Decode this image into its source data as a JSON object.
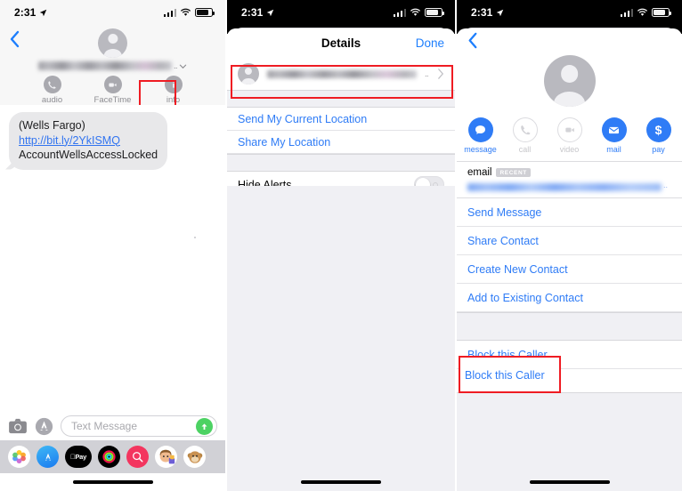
{
  "status_bar": {
    "time": "2:31",
    "location_icon": "location-arrow-icon",
    "cellular_icon": "cellular-bars-icon",
    "wifi_icon": "wifi-icon",
    "battery_icon": "battery-icon"
  },
  "colors": {
    "ios_blue": "#2f7cf6",
    "link_blue": "#1d7efd",
    "highlight_red": "#ef1c23",
    "send_green": "#4cd263",
    "bubble_gray": "#e8e8ea",
    "group_bg": "#f0f0f4"
  },
  "left_panel": {
    "name": "messages-thread",
    "back_icon": "back-chevron-icon",
    "avatar_icon": "person-avatar-icon",
    "contact_name_redacted": "",
    "contact_name_ellipsis": "..",
    "expand_icon": "chevron-down-icon",
    "actions": [
      {
        "label": "audio",
        "icon": "phone-icon",
        "highlighted": false
      },
      {
        "label": "FaceTime",
        "icon": "video-camera-icon",
        "highlighted": false
      },
      {
        "label": "info",
        "icon": "info-circle-icon",
        "highlighted": true
      }
    ],
    "message": {
      "prefix": "(Wells Fargo) ",
      "link_line1": "http://bit.ly/",
      "link_line2": "2YkISMQ",
      "suffix": "AccountWellsAccessLocked"
    },
    "composer": {
      "camera_icon": "camera-icon",
      "appstore_icon": "app-store-icon",
      "placeholder": "Text Message",
      "send_icon": "send-arrow-up-icon"
    },
    "app_drawer": [
      {
        "icon": "photos-icon"
      },
      {
        "icon": "app-store-icon"
      },
      {
        "icon": "apple-pay-icon",
        "label": "Pay"
      },
      {
        "icon": "activity-rings-icon"
      },
      {
        "icon": "images-search-icon"
      },
      {
        "icon": "memoji-girl-icon"
      },
      {
        "icon": "animoji-monkey-icon"
      }
    ],
    "home_indicator": "home-indicator"
  },
  "middle_panel": {
    "name": "details-sheet",
    "title": "Details",
    "done_label": "Done",
    "contact_row": {
      "avatar_icon": "person-avatar-icon",
      "value_redacted": "",
      "ellipsis": "..",
      "disclosure_icon": "chevron-right-icon",
      "highlighted": true
    },
    "links": [
      {
        "label": "Send My Current Location"
      },
      {
        "label": "Share My Location"
      }
    ],
    "hide_alerts": {
      "label": "Hide Alerts",
      "toggle_state": "off"
    },
    "home_indicator": "home-indicator"
  },
  "right_panel": {
    "name": "contact-card",
    "back_icon": "back-chevron-icon",
    "avatar_icon": "person-avatar-icon",
    "actions": [
      {
        "label": "message",
        "icon": "message-bubble-icon",
        "enabled": true
      },
      {
        "label": "call",
        "icon": "phone-icon",
        "enabled": false
      },
      {
        "label": "video",
        "icon": "video-camera-icon",
        "enabled": false
      },
      {
        "label": "mail",
        "icon": "envelope-icon",
        "enabled": true
      },
      {
        "label": "pay",
        "icon": "dollar-sign-icon",
        "enabled": true
      }
    ],
    "email_field": {
      "label": "email",
      "badge": "RECENT",
      "value_redacted": "",
      "ellipsis": ".."
    },
    "links": [
      {
        "label": "Send Message",
        "highlighted": false
      },
      {
        "label": "Share Contact",
        "highlighted": false
      },
      {
        "label": "Create New Contact",
        "highlighted": false
      },
      {
        "label": "Add to Existing Contact",
        "highlighted": false
      }
    ],
    "block_link": {
      "label": "Block this Caller",
      "highlighted": true
    },
    "home_indicator": "home-indicator"
  }
}
